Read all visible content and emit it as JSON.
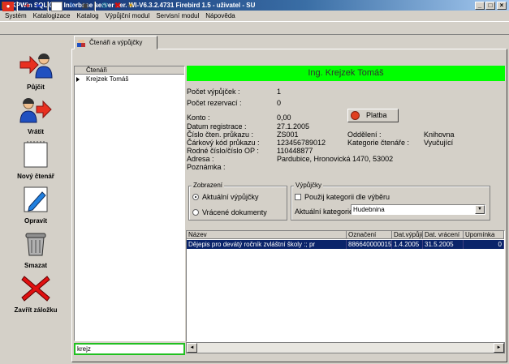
{
  "window": {
    "title": "KPWin SQL 0.1 - Interbase server ver. WI-V6.3.2.4731 Firebird 1.5 - uživatel - SU",
    "minimize": "_",
    "maximize": "□",
    "close": "×"
  },
  "menu": [
    "Systém",
    "Katalogizace",
    "Katalog",
    "Výpůjční modul",
    "Servisní modul",
    "Nápověda"
  ],
  "left_buttons": {
    "pujcit": "Půjčit",
    "vratit": "Vrátit",
    "novy": "Nový čtenář",
    "opravit": "Opravit",
    "smazat": "Smazat",
    "zavrit": "Zavřít záložku"
  },
  "tab": {
    "label": "Čtenáři a výpůjčky"
  },
  "reader_list": {
    "header": "Čtenáři",
    "rows": [
      "Krejzek Tomáš"
    ],
    "search_value": "krejz"
  },
  "reader": {
    "name": "Ing. Krejzek Tomáš",
    "loans_label": "Počet výpůjček :",
    "loans": "1",
    "reservations_label": "Počet rezervací :",
    "reservations": "0",
    "account_label": "Konto :",
    "account": "0,00",
    "registered_label": "Datum registrace :",
    "registered": "27.1.2005",
    "card_label": "Číslo čten. průkazu :",
    "card": "ZS001",
    "barcode_label": "Čárkový kód průkazu :",
    "barcode": "123456789012",
    "id_label": "Rodné číslo/číslo OP :",
    "id": "110448877",
    "address_label": "Adresa :",
    "address": "Pardubice, Hronovická 1470, 53002",
    "note_label": "Poznámka :",
    "dept_label": "Oddělení :",
    "dept": "Knihovna",
    "category_label": "Kategorie čtenáře :",
    "category": "Vyučující"
  },
  "platba_button": "Platba",
  "display_group": {
    "title": "Zobrazení",
    "option_current": "Aktuální výpůjčky",
    "option_returned": "Vrácené dokumenty"
  },
  "loans_group": {
    "title": "Výpůjčky",
    "use_category_label": "Použij kategorii dle výběru",
    "current_category_label": "Aktuální kategorie",
    "current_category_value": "Hudebnina"
  },
  "loans_table": {
    "columns": [
      "Název",
      "Označení",
      "Dat.výpůjčky",
      "Dat. vrácení",
      "Upomínka"
    ],
    "rows": [
      [
        "Dějepis pro devátý ročník zvláštní školy :; pr",
        "886640000015",
        "1.4.2005",
        "31.5.2005",
        "0"
      ]
    ]
  },
  "scroll": {
    "left": "◄",
    "right": "►"
  },
  "combo_arrow": "▼"
}
